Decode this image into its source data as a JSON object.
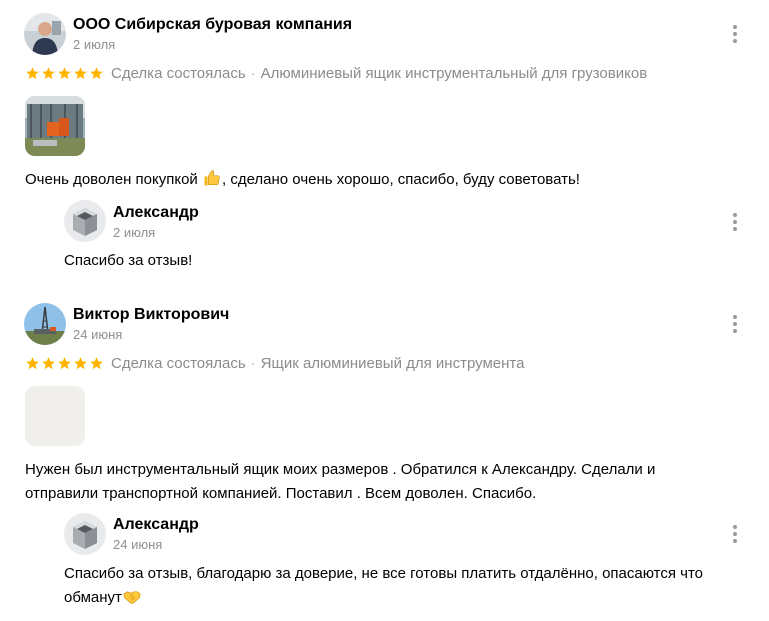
{
  "reviews": [
    {
      "author": "ООО Сибирская буровая компания",
      "date": "2 июля",
      "rating": 5,
      "status": "Сделка состоялась",
      "separator": "·",
      "product": "Алюминиевый ящик инструментальный для грузовиков",
      "text_before_emoji": "Очень доволен покупкой ",
      "emoji_icon": "thumbs-up-icon",
      "text_after_emoji": ", сделано очень хорошо, спасибо, буду советовать!",
      "reply": {
        "author": "Александр",
        "date": "2 июля",
        "text": "Спасибо за отзыв!"
      }
    },
    {
      "author": "Виктор Викторович",
      "date": "24 июня",
      "rating": 5,
      "status": "Сделка состоялась",
      "separator": "·",
      "product": "Ящик алюминиевый для инструмента",
      "text_line1": "Нужен был инструментальный ящик моих размеров . Обратился к Александру. Сделали и",
      "text_line2": "отправили транспортной компанией. Поставил . Всем доволен. Спасибо.",
      "reply": {
        "author": "Александр",
        "date": "24 июня",
        "text_line1": "Спасибо за отзыв, благодарю за доверие, не все готовы платить отдалённо, опасаются что",
        "text_line2": "обманут",
        "emoji_icon": "handshake-icon"
      }
    }
  ],
  "colors": {
    "star": "#ffb400",
    "muted_text": "#8f8f8f",
    "kebab": "#9a9a9a"
  }
}
